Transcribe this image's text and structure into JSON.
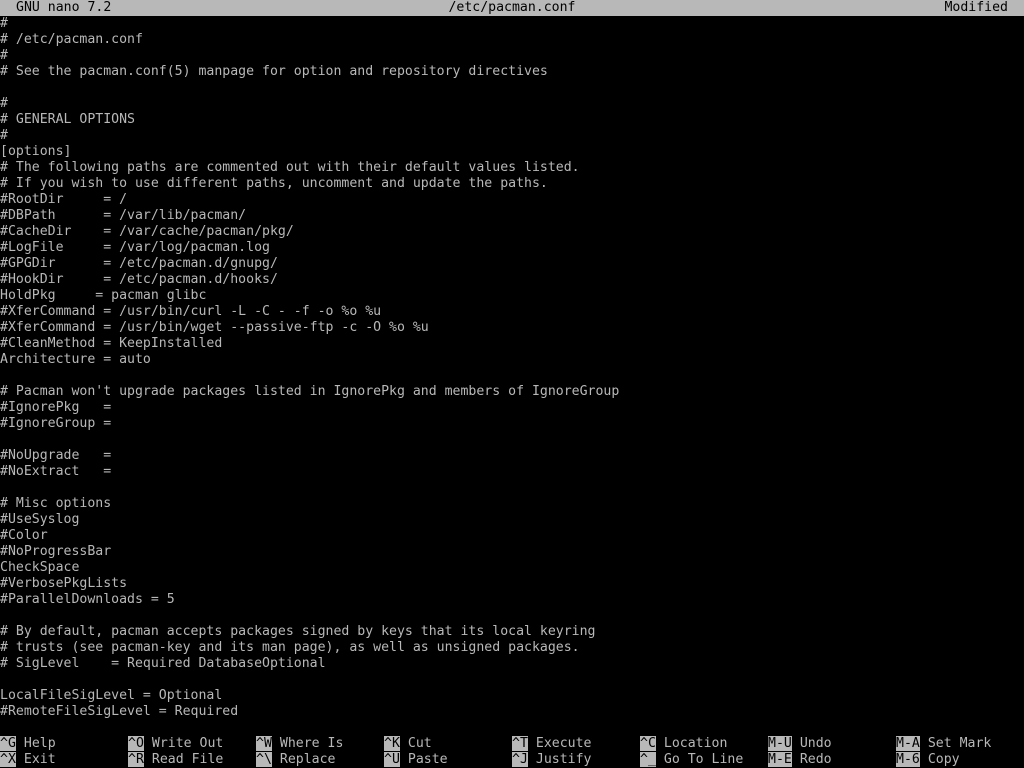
{
  "title_bar": {
    "app": "GNU nano 7.2",
    "filename": "/etc/pacman.conf",
    "status": "Modified"
  },
  "editor": {
    "lines": [
      "#",
      "# /etc/pacman.conf",
      "#",
      "# See the pacman.conf(5) manpage for option and repository directives",
      "",
      "#",
      "# GENERAL OPTIONS",
      "#",
      "[options]",
      "# The following paths are commented out with their default values listed.",
      "# If you wish to use different paths, uncomment and update the paths.",
      "#RootDir     = /",
      "#DBPath      = /var/lib/pacman/",
      "#CacheDir    = /var/cache/pacman/pkg/",
      "#LogFile     = /var/log/pacman.log",
      "#GPGDir      = /etc/pacman.d/gnupg/",
      "#HookDir     = /etc/pacman.d/hooks/",
      "HoldPkg     = pacman glibc",
      "#XferCommand = /usr/bin/curl -L -C - -f -o %o %u",
      "#XferCommand = /usr/bin/wget --passive-ftp -c -O %o %u",
      "#CleanMethod = KeepInstalled",
      "Architecture = auto",
      "",
      "# Pacman won't upgrade packages listed in IgnorePkg and members of IgnoreGroup",
      "#IgnorePkg   =",
      "#IgnoreGroup =",
      "",
      "#NoUpgrade   =",
      "#NoExtract   =",
      "",
      "# Misc options",
      "#UseSyslog",
      "#Color",
      "#NoProgressBar",
      "CheckSpace",
      "#VerbosePkgLists",
      "#ParallelDownloads = 5",
      "",
      "# By default, pacman accepts packages signed by keys that its local keyring",
      "# trusts (see pacman-key and its man page), as well as unsigned packages.",
      "# SigLevel    = Required DatabaseOptional",
      "",
      "LocalFileSigLevel = Optional",
      "#RemoteFileSigLevel = Required"
    ]
  },
  "shortcuts": [
    {
      "key": "^G",
      "label": "Help"
    },
    {
      "key": "^O",
      "label": "Write Out"
    },
    {
      "key": "^W",
      "label": "Where Is"
    },
    {
      "key": "^K",
      "label": "Cut"
    },
    {
      "key": "^T",
      "label": "Execute"
    },
    {
      "key": "^C",
      "label": "Location"
    },
    {
      "key": "M-U",
      "label": "Undo"
    },
    {
      "key": "M-A",
      "label": "Set Mark"
    },
    {
      "key": "^X",
      "label": "Exit"
    },
    {
      "key": "^R",
      "label": "Read File"
    },
    {
      "key": "^\\",
      "label": "Replace"
    },
    {
      "key": "^U",
      "label": "Paste"
    },
    {
      "key": "^J",
      "label": "Justify"
    },
    {
      "key": "^_",
      "label": "Go To Line"
    },
    {
      "key": "M-E",
      "label": "Redo"
    },
    {
      "key": "M-6",
      "label": "Copy"
    }
  ],
  "colors": {
    "background": "#000000",
    "foreground": "#b8b8b8",
    "inverse_bg": "#b8b8b8",
    "inverse_fg": "#000000"
  }
}
